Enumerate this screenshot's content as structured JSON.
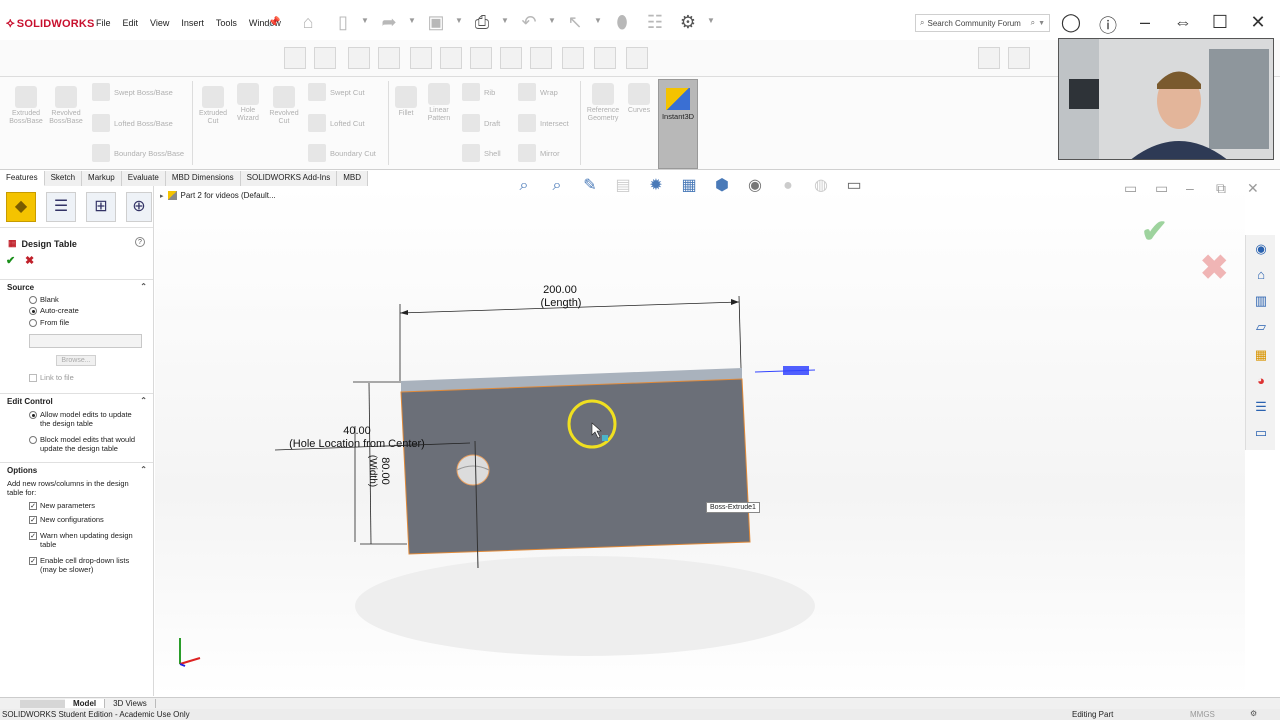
{
  "app": {
    "logo": "SOLIDWORKS",
    "menus": [
      "File",
      "Edit",
      "View",
      "Insert",
      "Tools",
      "Window"
    ]
  },
  "search": {
    "placeholder": "Search Community Forum"
  },
  "command_manager": {
    "features": [
      {
        "label": "Extruded\nBoss/Base"
      },
      {
        "label": "Revolved\nBoss/Base"
      },
      {
        "label": "Swept Boss/Base"
      },
      {
        "label": "Lofted Boss/Base"
      },
      {
        "label": "Boundary Boss/Base"
      },
      {
        "label": "Extruded\nCut"
      },
      {
        "label": "Hole\nWizard"
      },
      {
        "label": "Revolved\nCut"
      },
      {
        "label": "Swept Cut"
      },
      {
        "label": "Lofted Cut"
      },
      {
        "label": "Boundary Cut"
      },
      {
        "label": "Fillet"
      },
      {
        "label": "Linear\nPattern"
      },
      {
        "label": "Rib"
      },
      {
        "label": "Draft"
      },
      {
        "label": "Shell"
      },
      {
        "label": "Wrap"
      },
      {
        "label": "Intersect"
      },
      {
        "label": "Mirror"
      },
      {
        "label": "Reference\nGeometry"
      },
      {
        "label": "Curves"
      }
    ],
    "instant3d": "Instant3D"
  },
  "tabs": [
    "Features",
    "Sketch",
    "Markup",
    "Evaluate",
    "MBD Dimensions",
    "SOLIDWORKS Add-Ins",
    "MBD"
  ],
  "tree": {
    "part": "Part 2 for videos  (Default..."
  },
  "property_manager": {
    "title": "Design Table",
    "source": {
      "heading": "Source",
      "options": [
        "Blank",
        "Auto-create",
        "From file"
      ],
      "selected": "Auto-create",
      "browse": "Browse...",
      "link": "Link to file"
    },
    "edit_control": {
      "heading": "Edit Control",
      "options": [
        "Allow model edits to update the design table",
        "Block model edits that would update the design table"
      ],
      "selected": 0
    },
    "options": {
      "heading": "Options",
      "description": "Add new rows/columns in the design table for:",
      "checks": [
        "New parameters",
        "New configurations",
        "Warn when updating design table",
        "Enable cell drop-down lists (may be slower)"
      ]
    }
  },
  "model": {
    "dim_length_value": "200.00",
    "dim_length_name": "(Length)",
    "dim_hole_value": "40.00",
    "dim_hole_name": "(Hole Location from Center)",
    "dim_width_value": "80.00",
    "dim_width_name": "(Width)",
    "feature_tip": "Boss-Extrude1"
  },
  "bottom_tabs": [
    "Model",
    "3D Views"
  ],
  "status": {
    "left": "SOLIDWORKS Student Edition - Academic Use Only",
    "mode": "Editing Part",
    "units": "MMGS"
  }
}
